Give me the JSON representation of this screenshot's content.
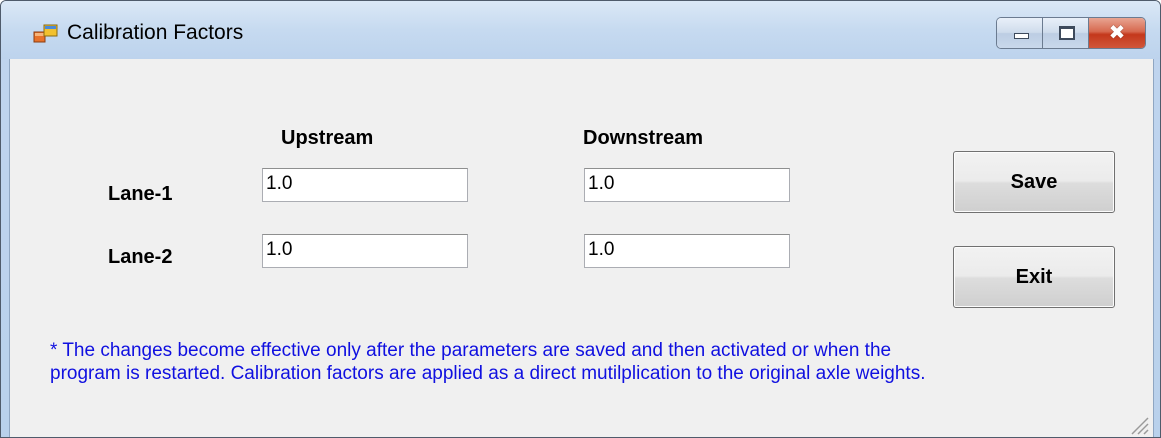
{
  "window": {
    "title": "Calibration Factors",
    "icon": "app-window-icon"
  },
  "caption_buttons": {
    "minimize": "minimize-icon",
    "maximize": "maximize-icon",
    "close": "✖"
  },
  "columns": {
    "upstream": "Upstream",
    "downstream": "Downstream"
  },
  "rows": [
    {
      "label": "Lane-1",
      "upstream": "1.0",
      "downstream": "1.0"
    },
    {
      "label": "Lane-2",
      "upstream": "1.0",
      "downstream": "1.0"
    }
  ],
  "buttons": {
    "save": "Save",
    "exit": "Exit"
  },
  "note_line1": "* The changes become effective only after the parameters are saved and then activated or when the",
  "note_line2": "program is restarted. Calibration factors are applied as a direct mutilplication to the original axle weights.",
  "colors": {
    "note_text": "#1010e0",
    "client_bg": "#f0f0f0",
    "close_button": "#c4381b"
  }
}
